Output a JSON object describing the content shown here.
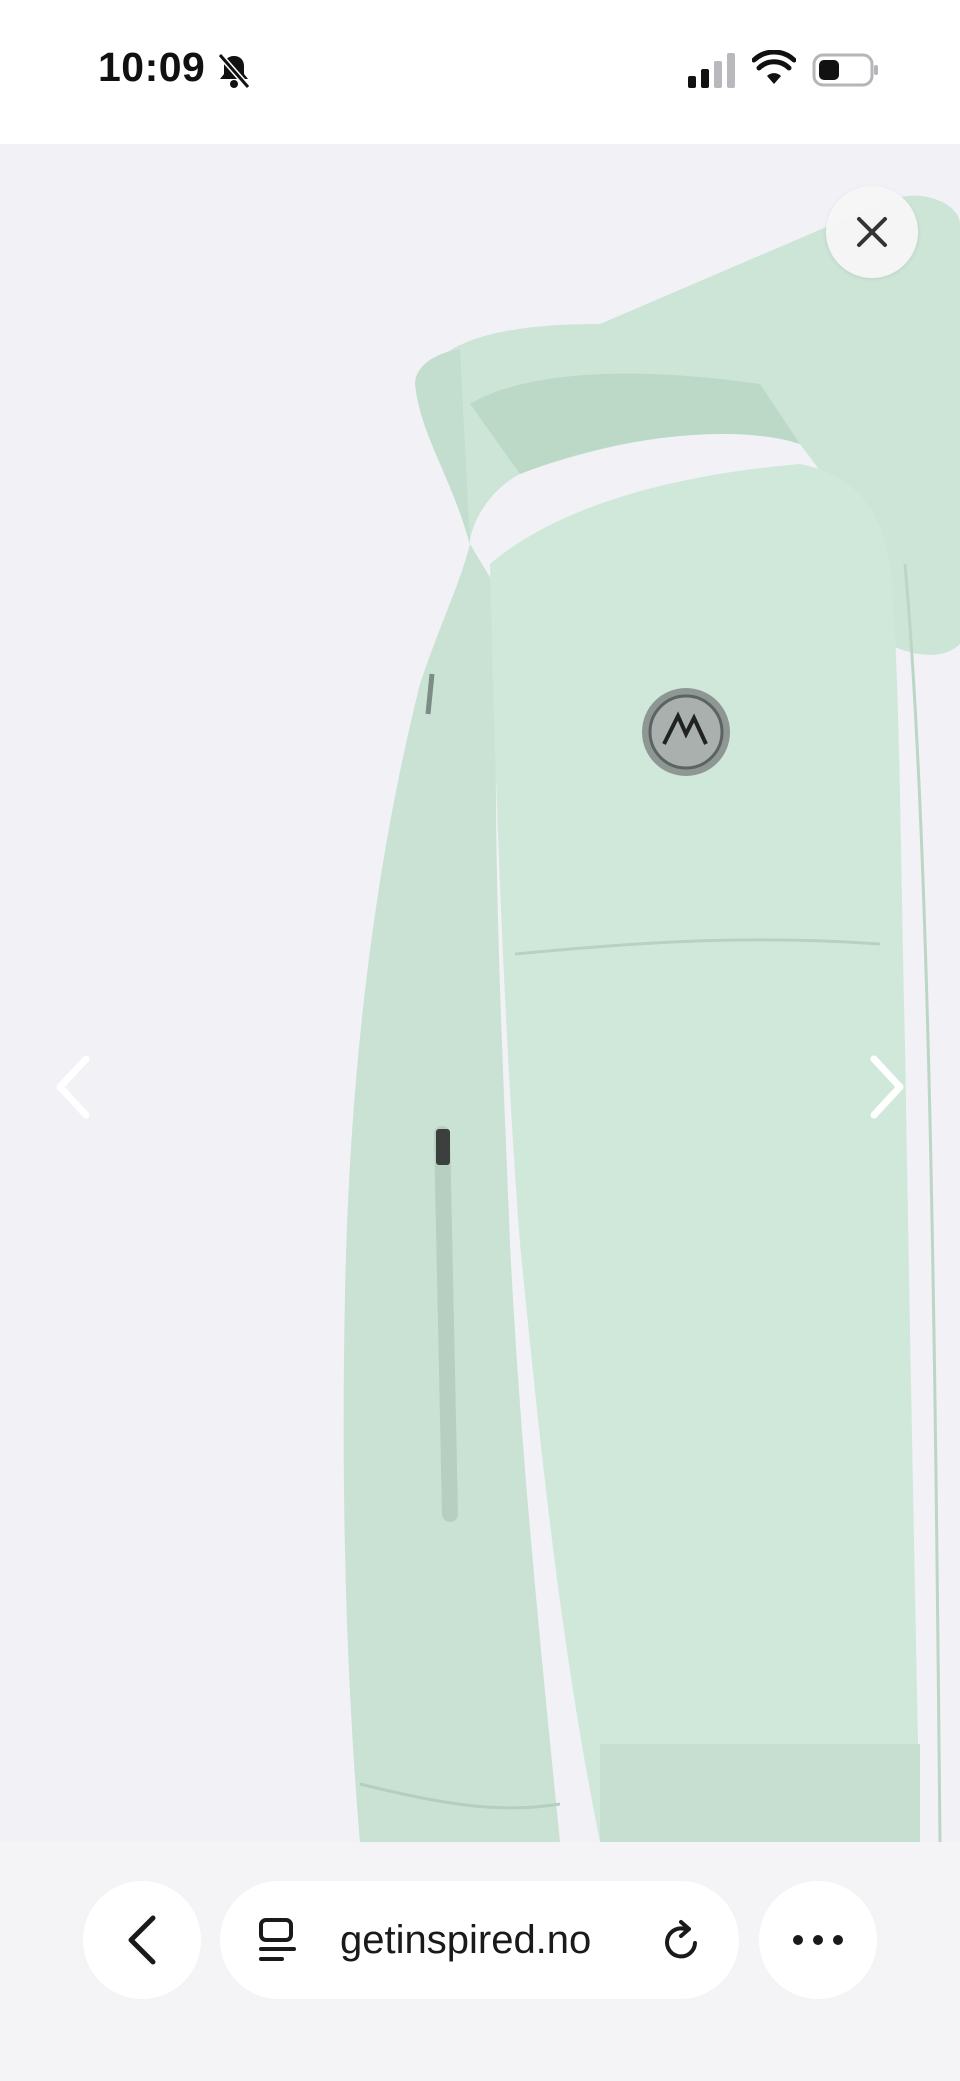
{
  "status_bar": {
    "time": "10:09",
    "icons": [
      "bell-slash-icon",
      "cellular-signal-icon",
      "wifi-icon",
      "battery-icon"
    ]
  },
  "viewer": {
    "image_description_name": "product-image-mint-jacket",
    "colors": {
      "background": "#f1f1f6",
      "jacket": "#cfe6da"
    },
    "icons": [
      "close-icon",
      "chevron-left-icon",
      "chevron-right-icon"
    ]
  },
  "browser_toolbar": {
    "url": "getinspired.no",
    "icons": [
      "back-icon",
      "reader-mode-icon",
      "reload-icon",
      "more-icon"
    ]
  }
}
